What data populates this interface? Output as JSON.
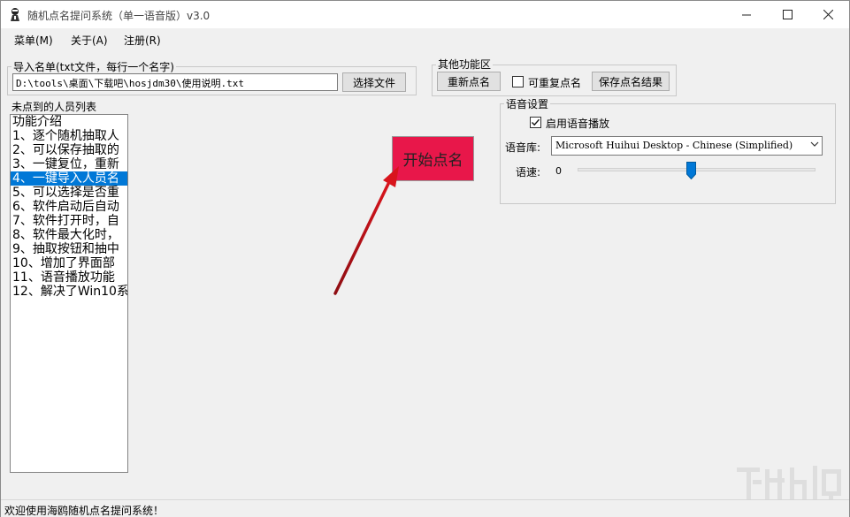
{
  "window": {
    "title": "随机点名提问系统（单一语音版）v3.0",
    "icons": {
      "app": "app-icon",
      "minimize": "minimize-icon",
      "maximize": "maximize-icon",
      "close": "close-icon"
    }
  },
  "menu": {
    "items": [
      {
        "label": "菜单(M)"
      },
      {
        "label": "关于(A)"
      },
      {
        "label": "注册(R)"
      }
    ]
  },
  "import": {
    "group_title": "导入名单(txt文件，每行一个名字)",
    "file_path": "D:\\tools\\桌面\\下载吧\\hosjdm30\\使用说明.txt",
    "choose_button": "选择文件"
  },
  "other": {
    "group_title": "其他功能区",
    "reset_button": "重新点名",
    "repeat_checkbox_label": "可重复点名",
    "repeat_checked": false,
    "save_button": "保存点名结果"
  },
  "list": {
    "group_title": "未点到的人员列表",
    "items": [
      "功能介绍",
      "1、逐个随机抽取人",
      "2、可以保存抽取的",
      "3、一键复位，重新",
      "4、一键导入人员名",
      "5、可以选择是否重",
      "6、软件启动后自动",
      "7、软件打开时，自",
      "8、软件最大化时，",
      "9、抽取按钮和抽中",
      "10、增加了界面部",
      "11、语音播放功能",
      "12、解决了Win10系"
    ],
    "selected_index": 4
  },
  "start": {
    "label": "开始点名",
    "color": "#e8174a"
  },
  "voice": {
    "group_title": "语音设置",
    "enable_label": "启用语音播放",
    "enable_checked": true,
    "library_label": "语音库:",
    "library_value": "Microsoft Huihui Desktop - Chinese (Simplified)",
    "speed_label": "语速:",
    "speed_value": "0",
    "speed_range": [
      -10,
      10
    ]
  },
  "status": {
    "text": "欢迎使用海鸥随机点名提问系统！"
  },
  "colors": {
    "accent": "#0078d7",
    "arrow": "#c0141c"
  }
}
